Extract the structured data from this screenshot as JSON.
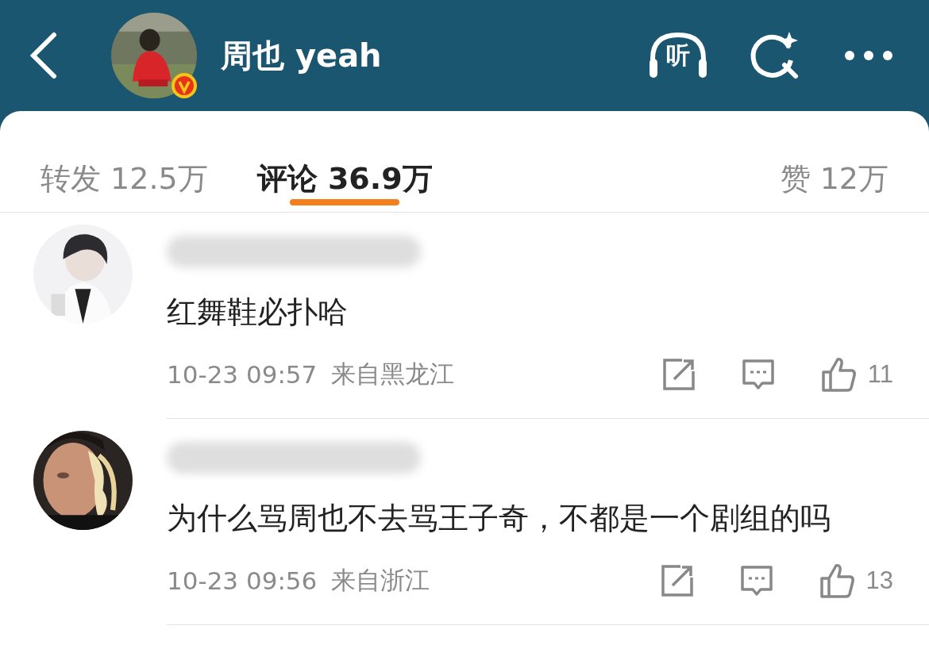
{
  "header": {
    "title": "周也 yeah",
    "listen_label": "听"
  },
  "tabs": [
    {
      "label": "转发 12.5万",
      "selected": false
    },
    {
      "label": "评论 36.9万",
      "selected": true
    },
    {
      "label": "赞 12万",
      "selected": false
    }
  ],
  "comments": [
    {
      "text": "红舞鞋必扑哈",
      "time": "10-23 09:57",
      "location": "来自黑龙江",
      "likes": "11"
    },
    {
      "text": "为什么骂周也不去骂王子奇，不都是一个剧组的吗",
      "time": "10-23 09:56",
      "location": "来自浙江",
      "likes": "13"
    }
  ]
}
